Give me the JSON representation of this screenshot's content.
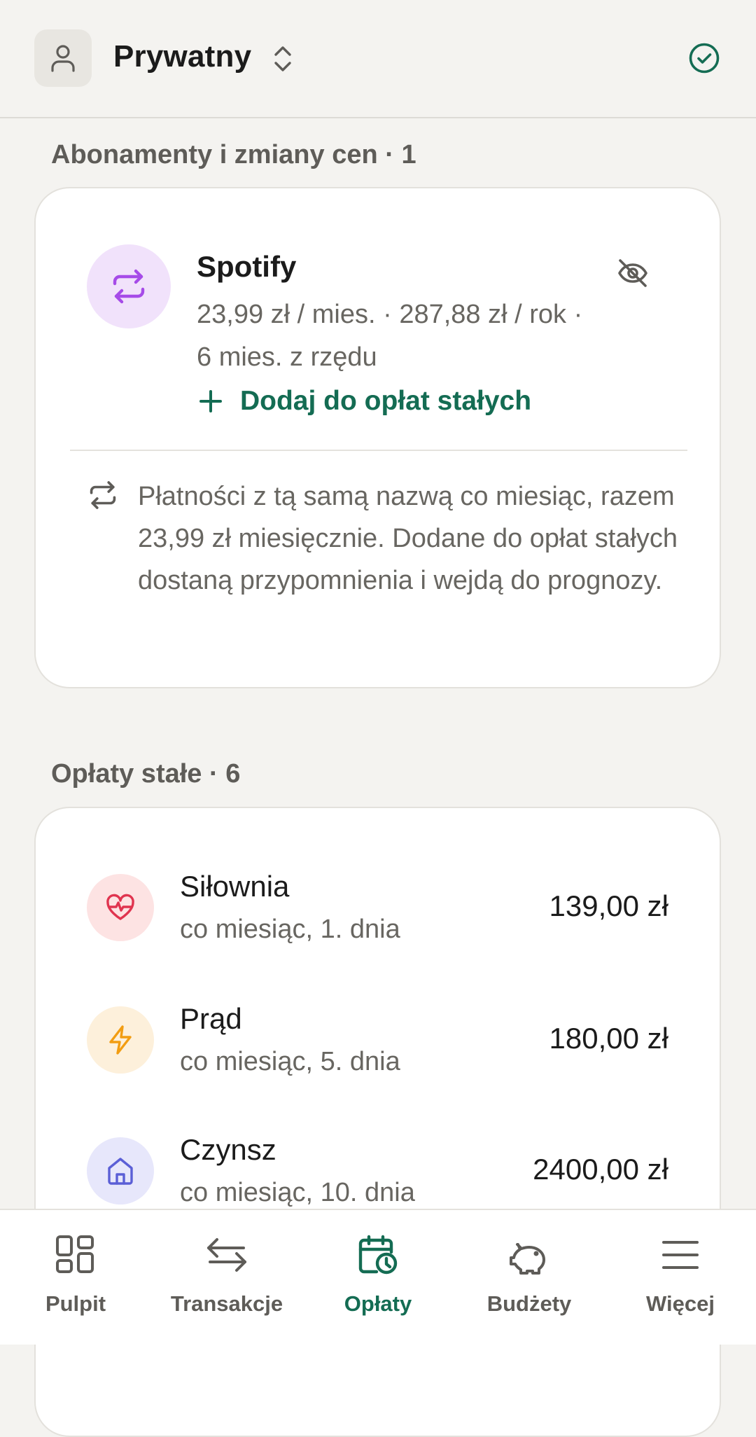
{
  "header": {
    "profile_icon": "user-icon",
    "profile_name": "Prywatny",
    "switch_icon": "chevron-up-down-icon",
    "status_icon": "check-circle-icon"
  },
  "subscriptions": {
    "section_title": "Abonamenty i zmiany cen · 1",
    "item": {
      "icon": "repeat-icon",
      "name": "Spotify",
      "details": "23,99 zł / mies. · 287,88 zł / rok · 6 mies. z rzędu",
      "hide_icon": "eye-off-icon",
      "add_label": "Dodaj do opłat stałych"
    },
    "info_icon": "repeat-icon",
    "info_text": "Płatności z tą samą nazwą co miesiąc, razem 23,99 zł miesięcznie. Dodane do opłat stałych dostaną przypomnienia i wejdą do prognozy."
  },
  "fixed_bills": {
    "section_title": "Opłaty stałe · 6",
    "items": [
      {
        "name": "Siłownia",
        "schedule": "co miesiąc, 1. dnia",
        "amount": "139,00 zł",
        "icon": "heart-pulse-icon",
        "color": "#e0344f",
        "bg": "#fde3e3"
      },
      {
        "name": "Prąd",
        "schedule": "co miesiąc, 5. dnia",
        "amount": "180,00 zł",
        "icon": "lightning-icon",
        "color": "#f29d12",
        "bg": "#fdf0db"
      },
      {
        "name": "Czynsz",
        "schedule": "co miesiąc, 10. dnia",
        "amount": "2400,00 zł",
        "icon": "home-icon",
        "color": "#5b5fd6",
        "bg": "#e7e7fb"
      }
    ]
  },
  "nav": {
    "items": [
      {
        "label": "Pulpit",
        "icon": "dashboard-icon"
      },
      {
        "label": "Transakcje",
        "icon": "arrows-exchange-icon"
      },
      {
        "label": "Opłaty",
        "icon": "calendar-clock-icon",
        "active": true
      },
      {
        "label": "Budżety",
        "icon": "piggy-bank-icon"
      },
      {
        "label": "Więcej",
        "icon": "menu-icon"
      }
    ]
  },
  "colors": {
    "accent": "#146c53",
    "background": "#f4f3f0",
    "card": "#ffffff",
    "muted_text": "#686661",
    "spotify_bg": "#f1e2fb",
    "spotify_icon": "#a64be8"
  }
}
